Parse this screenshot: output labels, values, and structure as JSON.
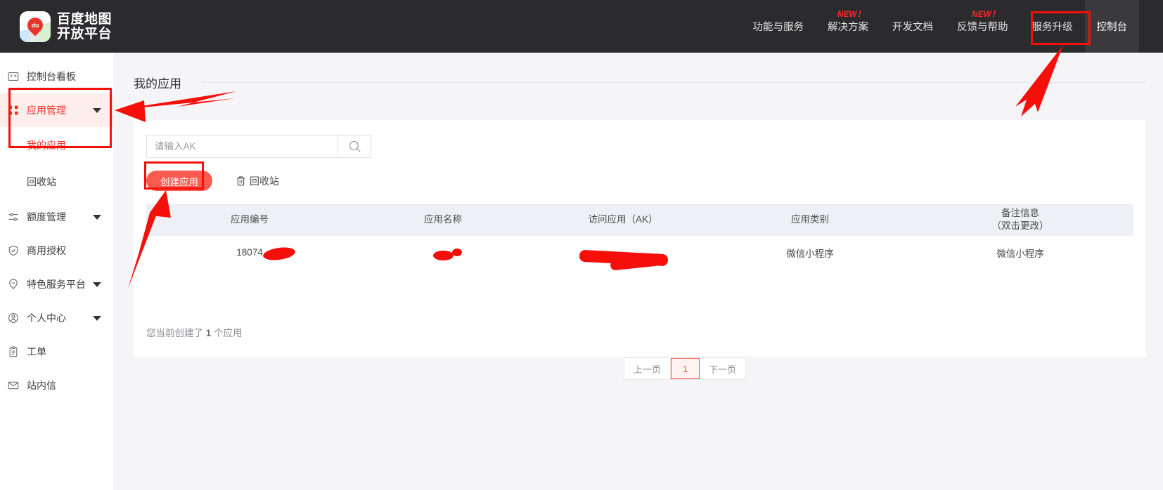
{
  "brand": {
    "line1": "百度地图",
    "line2": "开放平台",
    "pin_text": "du",
    "icon": "baidu-map-pin-logo"
  },
  "topnav": {
    "background": "#2b2b2d",
    "items": [
      {
        "label": "功能与服务",
        "badge": "",
        "active": false
      },
      {
        "label": "解决方案",
        "badge": "NEW！",
        "active": false
      },
      {
        "label": "开发文档",
        "badge": "",
        "active": false
      },
      {
        "label": "反馈与帮助",
        "badge": "NEW！",
        "active": false
      },
      {
        "label": "服务升级",
        "badge": "",
        "active": false
      },
      {
        "label": "控制台",
        "badge": "",
        "active": true
      }
    ]
  },
  "sidebar": {
    "items": [
      {
        "label": "控制台看板",
        "icon": "dashboard-icon",
        "caret": false,
        "active": false
      },
      {
        "label": "应用管理",
        "icon": "apps-grid-icon",
        "caret": true,
        "active": true
      },
      {
        "label": "额度管理",
        "icon": "sliders-icon",
        "caret": true,
        "active": false
      },
      {
        "label": "商用授权",
        "icon": "shield-check-icon",
        "caret": false,
        "active": false
      },
      {
        "label": "特色服务平台",
        "icon": "map-pin-icon",
        "caret": true,
        "active": false
      },
      {
        "label": "个人中心",
        "icon": "user-circle-icon",
        "caret": true,
        "active": false
      },
      {
        "label": "工单",
        "icon": "clipboard-icon",
        "caret": false,
        "active": false
      },
      {
        "label": "站内信",
        "icon": "envelope-icon",
        "caret": false,
        "active": false
      }
    ],
    "subitems": [
      {
        "label": "我的应用",
        "selected": true
      },
      {
        "label": "回收站",
        "selected": false
      }
    ],
    "active_color": "#e8352c"
  },
  "page": {
    "title": "我的应用"
  },
  "search": {
    "value": "",
    "placeholder": "请输入AK",
    "icon": "search-icon"
  },
  "toolbar": {
    "create_label": "创建应用",
    "create_color": "#fa5a50",
    "recycle_label": "回收站",
    "recycle_icon": "trash-icon"
  },
  "table": {
    "headers": [
      {
        "line1": "应用编号",
        "line2": ""
      },
      {
        "line1": "应用名称",
        "line2": ""
      },
      {
        "line1": "访问应用（AK）",
        "line2": ""
      },
      {
        "line1": "应用类别",
        "line2": ""
      },
      {
        "line1": "备注信息",
        "line2": "（双击更改）"
      }
    ],
    "rows": [
      {
        "app_id": "18074",
        "app_id_redacted": true,
        "app_name": "",
        "app_name_redacted": true,
        "ak": "",
        "ak_redacted": true,
        "category": "微信小程序",
        "remark": "微信小程序"
      }
    ]
  },
  "summary": {
    "prefix": "您当前创建了 ",
    "count": "1",
    "suffix": " 个应用"
  },
  "pagination": {
    "prev_label": "上一页",
    "current_page": "1",
    "next_label": "下一页",
    "active_color": "#fa5a50"
  },
  "annotations": {
    "color": "#f50f0a",
    "boxes": [
      {
        "name": "console-nav-highlight-box"
      },
      {
        "name": "app-management-menu-highlight-box"
      },
      {
        "name": "create-app-button-highlight-box"
      }
    ],
    "arrows": [
      {
        "name": "arrow-to-console-nav"
      },
      {
        "name": "arrow-to-app-management-menu"
      },
      {
        "name": "arrow-to-create-app-button"
      }
    ]
  }
}
